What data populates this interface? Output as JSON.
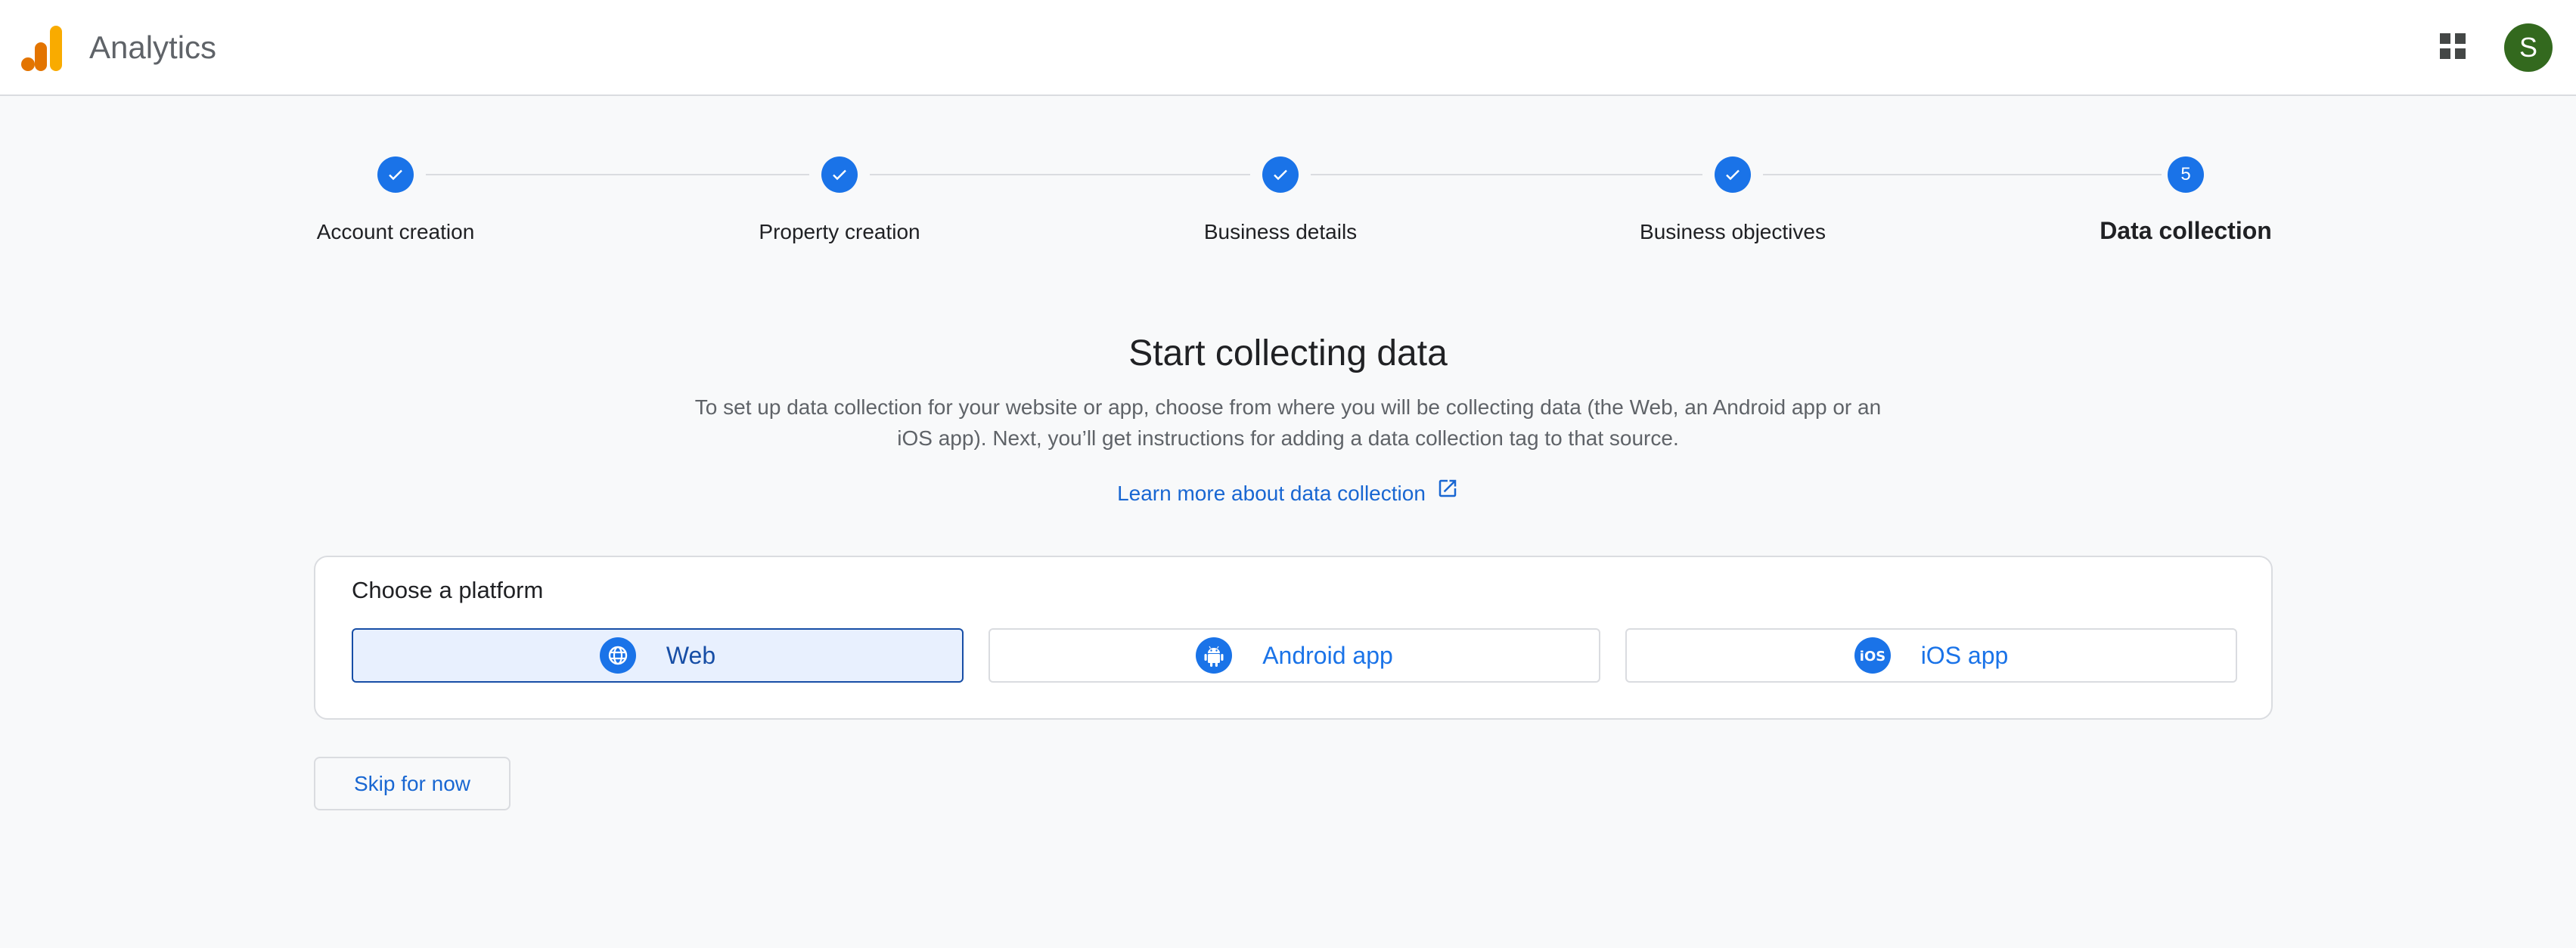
{
  "header": {
    "app_title": "Analytics",
    "apps_icon": "apps-grid-icon",
    "avatar_initial": "S",
    "avatar_color": "#33691e"
  },
  "stepper": {
    "steps": [
      {
        "label": "Account creation",
        "state": "completed",
        "icon": "check-icon"
      },
      {
        "label": "Property creation",
        "state": "completed",
        "icon": "check-icon"
      },
      {
        "label": "Business details",
        "state": "completed",
        "icon": "check-icon"
      },
      {
        "label": "Business objectives",
        "state": "completed",
        "icon": "check-icon"
      },
      {
        "label": "Data collection",
        "state": "active",
        "number": "5"
      }
    ],
    "accent_color": "#1a73e8"
  },
  "main": {
    "title": "Start collecting data",
    "description": "To set up data collection for your website or app, choose from where you will be collecting data (the Web, an Android app or an iOS app). Next, you’ll get instructions for adding a data collection tag to that source.",
    "learn_more_link": "Learn more about data collection",
    "learn_more_icon": "open-in-new-icon"
  },
  "platform_card": {
    "title": "Choose a platform",
    "options": [
      {
        "label": "Web",
        "icon": "globe-icon",
        "selected": true
      },
      {
        "label": "Android app",
        "icon": "android-icon",
        "selected": false
      },
      {
        "label": "iOS app",
        "icon": "ios-icon",
        "selected": false
      }
    ]
  },
  "actions": {
    "skip_label": "Skip for now"
  }
}
